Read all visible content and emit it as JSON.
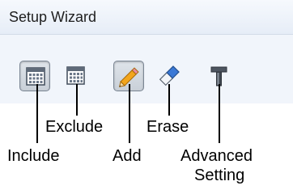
{
  "window": {
    "title": "Setup Wizard"
  },
  "toolbar": {
    "buttons": [
      {
        "id": "include",
        "icon": "calendar-include-icon",
        "pressed": true
      },
      {
        "id": "exclude",
        "icon": "calendar-exclude-icon",
        "pressed": false
      },
      {
        "id": "add",
        "icon": "pencil-icon",
        "pressed": true
      },
      {
        "id": "erase",
        "icon": "eraser-icon",
        "pressed": false
      },
      {
        "id": "advanced",
        "icon": "hammer-icon",
        "pressed": false
      }
    ]
  },
  "callouts": {
    "include": "Include",
    "exclude": "Exclude",
    "add": "Add",
    "erase": "Erase",
    "advanced_line1": "Advanced",
    "advanced_line2": "Setting"
  },
  "colors": {
    "calendar_header": "#5f6a79",
    "pencil_body": "#f2a51c",
    "eraser_body": "#3b79d6"
  }
}
